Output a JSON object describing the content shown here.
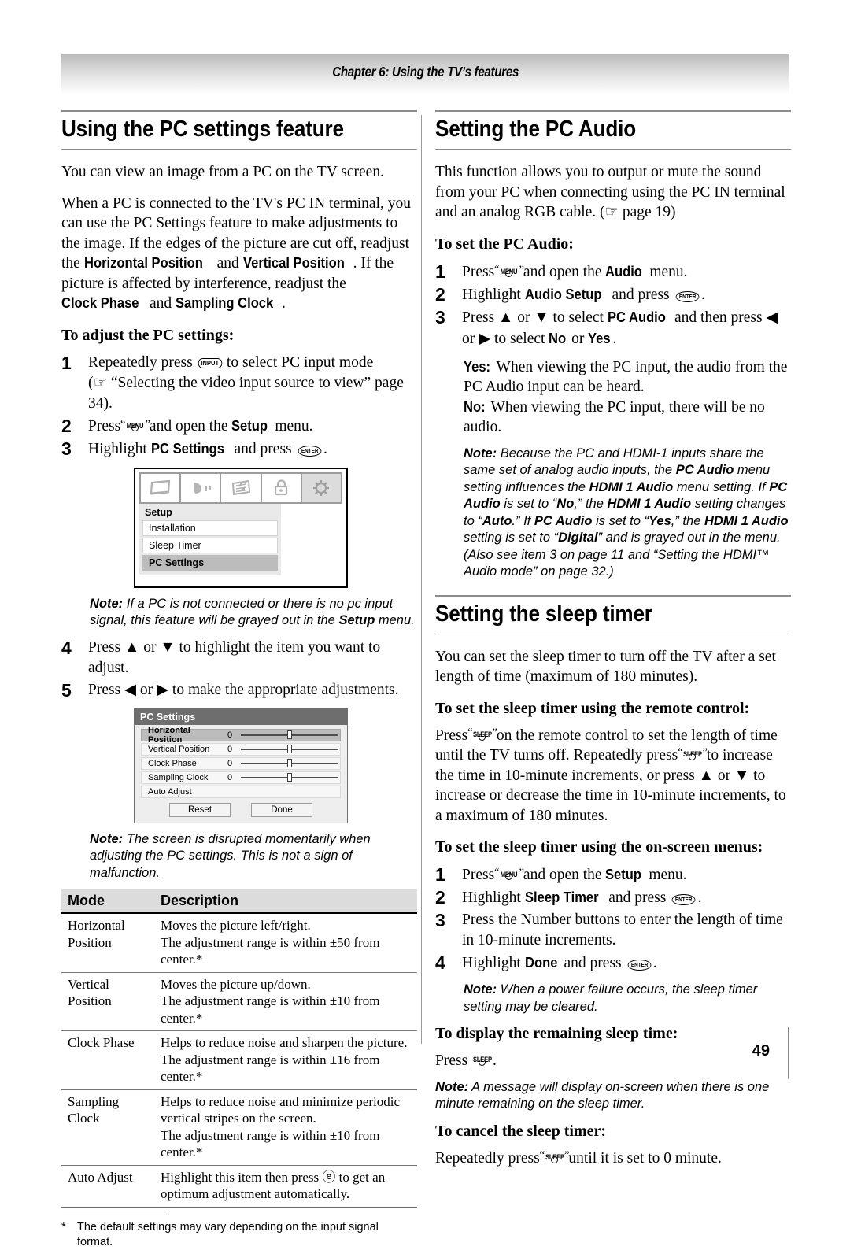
{
  "header": {
    "chapter": "Chapter 6: Using the TV’s features"
  },
  "page": {
    "number": "49"
  },
  "left": {
    "section_title": "Using the PC settings feature",
    "intro": {
      "p1": "You can view an image from a PC on the TV screen.",
      "p2a": "When a PC is connected to the TV's PC IN terminal, you can use the PC Settings feature to make adjustments to the image. If the edges of the picture are cut off, readjust the ",
      "em1": "Horizontal Position",
      "p2b": " and ",
      "em2": "Vertical Position",
      "p2c": ". If the picture is affected by interference, readjust the ",
      "em3": "Clock Phase",
      "p2d": " and ",
      "em4": "Sampling Clock",
      "p2e": "."
    },
    "subhead_adjust": "To adjust the PC settings:",
    "steps": [
      {
        "num": "1",
        "a": "Repeatedly press ",
        "key": "INPUT",
        "b": " to select PC input mode",
        "c": "(☞ “Selecting the video input source to view” page 34)."
      },
      {
        "num": "2",
        "a": "Press ",
        "key": "MENU",
        "b": " and open the ",
        "em": "Setup",
        "c": " menu."
      },
      {
        "num": "3",
        "a": "Highlight ",
        "em": "PC Settings",
        "b": " and press ",
        "key": "ENTER",
        "c": "."
      }
    ],
    "osd_setup": {
      "title": "Setup",
      "tabs": [
        "picture-icon",
        "audio-icon",
        "preferences-icon",
        "lock-icon",
        "setup-gear-icon"
      ],
      "selected_tab_index": 4,
      "items": [
        {
          "label": "Installation",
          "selected": false
        },
        {
          "label": "Sleep Timer",
          "selected": false
        },
        {
          "label": "PC Settings",
          "selected": true
        }
      ]
    },
    "note1": {
      "label": "Note:",
      "a": " If a PC is not connected or there is no pc input signal, this feature will be grayed out in the ",
      "em": "Setup",
      "b": " menu."
    },
    "steps2": [
      {
        "num": "4",
        "a": "Press ▲ or ▼ to highlight the item you want to adjust."
      },
      {
        "num": "5",
        "a": "Press ◀ or ▶ to make the appropriate adjustments."
      }
    ],
    "osd_pc": {
      "title": "PC Settings",
      "rows": [
        {
          "label": "Horizontal Position",
          "value": "0",
          "slider": true,
          "selected": true
        },
        {
          "label": "Vertical Position",
          "value": "0",
          "slider": true,
          "selected": false
        },
        {
          "label": "Clock Phase",
          "value": "0",
          "slider": true,
          "selected": false
        },
        {
          "label": "Sampling Clock",
          "value": "0",
          "slider": true,
          "selected": false
        },
        {
          "label": "Auto Adjust",
          "value": "",
          "slider": false,
          "selected": false
        }
      ],
      "buttons": [
        "Reset",
        "Done"
      ]
    },
    "note2": {
      "label": "Note:",
      "a": " The screen is disrupted momentarily when adjusting the PC settings. This is not a sign of malfunction."
    },
    "table": {
      "headers": [
        "Mode",
        "Description"
      ],
      "rows": [
        {
          "mode": "Horizontal Position",
          "desc": [
            "Moves the picture left/right.",
            "The adjustment range is within ±50 from center.*"
          ]
        },
        {
          "mode": "Vertical Position",
          "desc": [
            "Moves the picture up/down.",
            "The adjustment range is within ±10 from center.*"
          ]
        },
        {
          "mode": "Clock Phase",
          "desc": [
            "Helps to reduce noise and sharpen the picture.",
            "The adjustment range is within ±16 from center.*"
          ]
        },
        {
          "mode": "Sampling Clock",
          "desc": [
            "Helps to reduce noise and minimize periodic vertical stripes on the screen.",
            "The adjustment range is within ±10 from center.*"
          ]
        },
        {
          "mode": "Auto Adjust",
          "desc": [
            "Highlight this item then press ⓔ to get an optimum adjustment automatically."
          ]
        }
      ]
    },
    "footnote": {
      "star": "*",
      "text": "The default settings may vary depending on the input signal format."
    }
  },
  "right": {
    "section_title_audio": "Setting the PC Audio",
    "audio_intro": "This function allows you to output or mute the sound from your PC when connecting using the PC IN terminal and an analog RGB cable. (☞ page 19)",
    "subhead_audio": "To set the PC Audio:",
    "audio_steps": [
      {
        "num": "1",
        "a": "Press ",
        "key": "MENU",
        "b": " and open the ",
        "em": "Audio",
        "c": " menu."
      },
      {
        "num": "2",
        "a": "Highlight ",
        "em": "Audio Setup",
        "b": " and press ",
        "key": "ENTER",
        "c": "."
      },
      {
        "num": "3",
        "a": "Press ▲ or ▼ to select ",
        "em": "PC Audio",
        "b": " and then press ◀ or ▶ to select ",
        "em2": "No",
        "c": " or ",
        "em3": "Yes",
        "d": "."
      }
    ],
    "yes_label": "Yes:",
    "yes_text": " When viewing the PC input, the audio from the PC Audio input can be heard.",
    "no_label": "No:",
    "no_text": " When viewing the PC input, there will be no audio.",
    "audio_note": {
      "label": "Note:",
      "t1": " Because the PC and HDMI-1 inputs share the same set of analog audio inputs, the ",
      "b1": "PC Audio",
      "t2": " menu setting influences the ",
      "b2": "HDMI 1 Audio",
      "t3": " menu setting. If ",
      "b3": "PC Audio",
      "t4": " is set to “",
      "b4": "No",
      "t5": ",” the ",
      "b5": "HDMI 1 Audio",
      "t6": " setting changes to “",
      "b6": "Auto",
      "t7": ".” If ",
      "b7": "PC Audio",
      "t8": " is set to “",
      "b8": "Yes",
      "t9": ",” the ",
      "b9": "HDMI 1 Audio",
      "t10": " setting is set to “",
      "b10": "Digital",
      "t11": "” and is grayed out in the menu. (Also see item 3 on page 11 and “Setting the HDMI™ Audio mode” on page 32.)"
    },
    "section_title_sleep": "Setting the sleep timer",
    "sleep_intro": "You can set the sleep timer to turn off the TV after a set length of time (maximum of 180 minutes).",
    "subhead_remote": "To set the sleep timer using the remote control:",
    "remote_text": {
      "a": "Press ",
      "key1": "SLEEP",
      "b": " on the remote control to set the length of time until the TV turns off. Repeatedly press ",
      "key2": "SLEEP",
      "c": " to increase the time in 10-minute increments, or press ▲ or ▼ to increase or decrease the time in 10-minute increments, to a maximum of 180 minutes."
    },
    "subhead_onscreen": "To set the sleep timer using the on-screen menus:",
    "sleep_steps": [
      {
        "num": "1",
        "a": "Press ",
        "key": "MENU",
        "b": " and open the ",
        "em": "Setup",
        "c": " menu."
      },
      {
        "num": "2",
        "a": "Highlight ",
        "em": "Sleep Timer",
        "b": " and press ",
        "key": "ENTER",
        "c": "."
      },
      {
        "num": "3",
        "a": "Press the Number buttons to enter the length of time in 10-minute increments."
      },
      {
        "num": "4",
        "a": "Highlight ",
        "em": "Done",
        "b": " and press ",
        "key": "ENTER",
        "c": "."
      }
    ],
    "sleep_note": {
      "label": "Note:",
      "a": " When a power failure occurs, the sleep timer setting may be cleared."
    },
    "subhead_display": "To display the remaining sleep time:",
    "display_text": {
      "a": "Press ",
      "key": "SLEEP",
      "b": "."
    },
    "display_note": {
      "label": "Note:",
      "a": " A message will display on-screen when there is one minute remaining on the sleep timer."
    },
    "subhead_cancel": "To cancel the sleep timer:",
    "cancel_text": {
      "a": "Repeatedly press ",
      "key": "SLEEP",
      "b": " until it is set to 0 minute."
    }
  },
  "keys": {
    "input": "INPUT",
    "menu": "MENU",
    "enter": "ENTER",
    "sleep": "SLEEP"
  }
}
